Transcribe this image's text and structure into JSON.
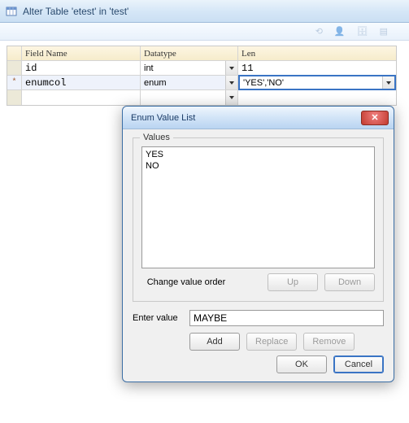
{
  "titlebar": {
    "title": "Alter Table 'etest' in 'test'"
  },
  "grid": {
    "headers": {
      "field": "Field Name",
      "type": "Datatype",
      "len": "Len"
    },
    "rows": [
      {
        "gutter": "",
        "field": "id",
        "type": "int",
        "len": "11"
      },
      {
        "gutter": "*",
        "field": "enumcol",
        "type": "enum",
        "len": "'YES','NO'"
      },
      {
        "gutter": "",
        "field": "",
        "type": "",
        "len": ""
      }
    ]
  },
  "modal": {
    "title": "Enum Value List",
    "values_label": "Values",
    "values": [
      "YES",
      "NO"
    ],
    "order_label": "Change value order",
    "up_label": "Up",
    "down_label": "Down",
    "enter_label": "Enter value",
    "enter_value": "MAYBE",
    "add_label": "Add",
    "replace_label": "Replace",
    "remove_label": "Remove",
    "ok_label": "OK",
    "cancel_label": "Cancel"
  }
}
